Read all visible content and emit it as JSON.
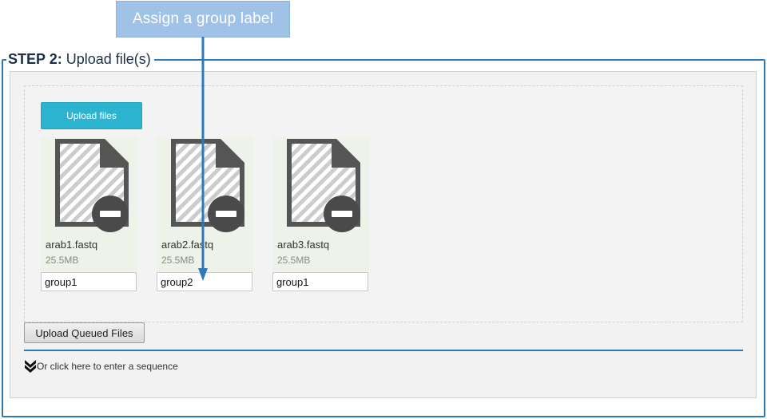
{
  "callout": {
    "text": "Assign a group label"
  },
  "step": {
    "number_label": "STEP 2:",
    "title": "Upload file(s)"
  },
  "upload_button_label": "Upload files",
  "files": [
    {
      "name": "arab1.fastq",
      "size": "25.5MB",
      "group": "group1"
    },
    {
      "name": "arab2.fastq",
      "size": "25.5MB",
      "group": "group2"
    },
    {
      "name": "arab3.fastq",
      "size": "25.5MB",
      "group": "group1"
    }
  ],
  "queue_button_label": "Upload Queued Files",
  "sequence_toggle_label": "Or click here to enter a sequence",
  "colors": {
    "accent_blue": "#2e7ab8",
    "upload_button": "#2cb3cf",
    "callout": "#9fc2e6",
    "file_icon": "#555555"
  },
  "icons": {
    "file": "file-icon",
    "remove": "remove-icon",
    "expand": "double-chevron-down-icon"
  }
}
